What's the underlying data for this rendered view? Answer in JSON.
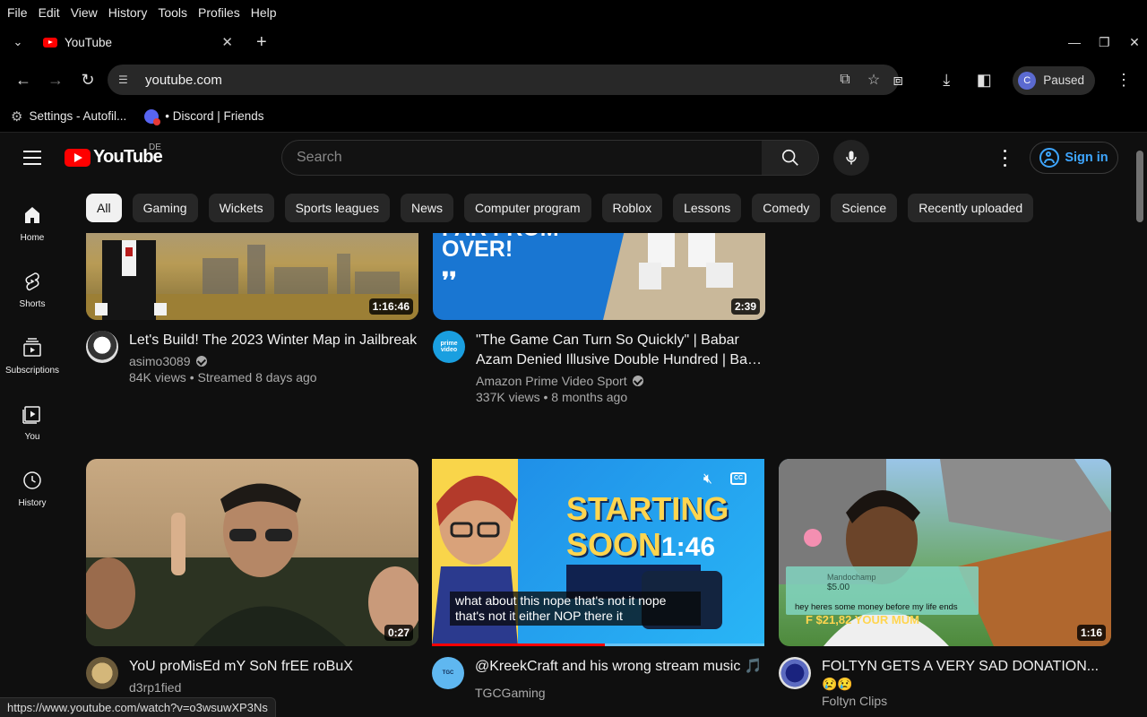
{
  "menubar": [
    "File",
    "Edit",
    "View",
    "History",
    "Tools",
    "Profiles",
    "Help"
  ],
  "tab": {
    "title": "YouTube"
  },
  "omnibox": {
    "url": "youtube.com"
  },
  "profile": {
    "initial": "C",
    "status": "Paused"
  },
  "bookmarks": [
    {
      "label": "Settings - Autofil...",
      "icon": "gear-icon"
    },
    {
      "label": "• Discord | Friends",
      "icon": "discord-icon"
    }
  ],
  "youtube": {
    "logo_text": "YouTube",
    "country_code": "DE",
    "search_placeholder": "Search",
    "sign_in": "Sign in",
    "chips": [
      "All",
      "Gaming",
      "Wickets",
      "Sports leagues",
      "News",
      "Computer program",
      "Roblox",
      "Lessons",
      "Comedy",
      "Science",
      "Recently uploaded"
    ],
    "active_chip": "All",
    "guide": [
      {
        "label": "Home",
        "icon": "home-icon"
      },
      {
        "label": "Shorts",
        "icon": "shorts-icon"
      },
      {
        "label": "Subscriptions",
        "icon": "subscriptions-icon"
      },
      {
        "label": "You",
        "icon": "you-icon"
      },
      {
        "label": "History",
        "icon": "history-icon"
      }
    ],
    "videos": [
      {
        "title": "Let's Build! The 2023 Winter Map in Jailbreak",
        "channel": "asimo3089",
        "verified": true,
        "stats": "84K views • Streamed 8 days ago",
        "duration": "1:16:46"
      },
      {
        "title": "\"The Game Can Turn So Quickly\" | Babar Azam Denied Illusive Double Hundred | Ban v Pak...",
        "channel": "Amazon Prime Video Sport",
        "verified": true,
        "stats": "337K views • 8 months ago",
        "duration": "2:39",
        "thumb_text": "FAR FROM OVER!"
      },
      {
        "title": "YoU proMisEd mY SoN frEE roBuX",
        "channel": "d3rp1fied",
        "verified": false,
        "stats": "",
        "duration": "0:27"
      },
      {
        "title": "@KreekCraft and his wrong stream music 🎵",
        "channel": "TGCGaming",
        "verified": false,
        "stats": "",
        "duration": "",
        "thumb_text": "STARTING SOON",
        "thumb_time": "1:46",
        "caption": "what about this nope that's not it nope that's not it either NOP there it"
      },
      {
        "title": "FOLTYN GETS A VERY SAD DONATION...",
        "subtitle": "😢😢",
        "channel": "Foltyn Clips",
        "verified": false,
        "stats": "",
        "duration": "1:16",
        "donation_name": "Mandochamp",
        "donation_amount": "$5.00",
        "donation_msg": "hey heres some money before my life ends",
        "donation_total": "F $21,82 YOUR MUM"
      }
    ]
  },
  "status_url": "https://www.youtube.com/watch?v=o3wsuwXP3Ns"
}
